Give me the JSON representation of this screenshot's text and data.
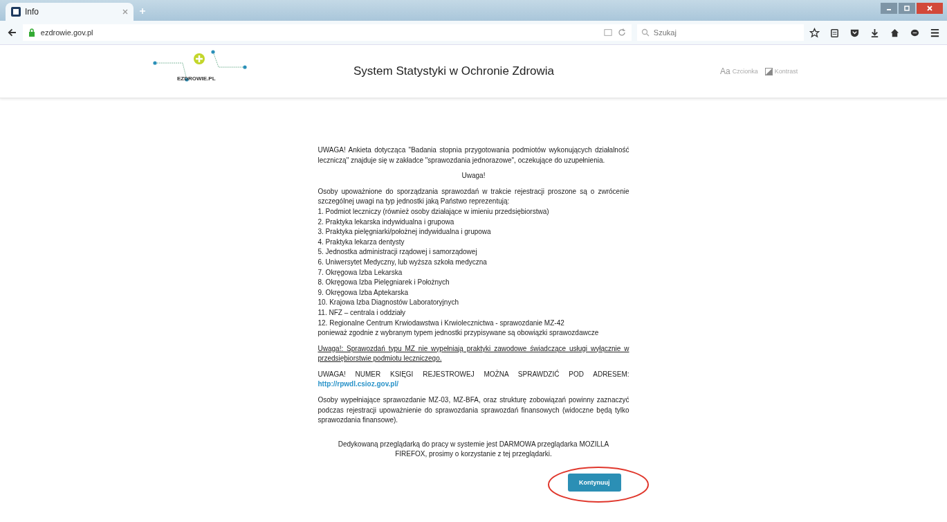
{
  "browser": {
    "tab_title": "Info",
    "url": "ezdrowie.gov.pl",
    "search_placeholder": "Szukaj"
  },
  "header": {
    "logo_text": "EZDROWIE.PL",
    "title": "System Statystyki w Ochronie Zdrowia",
    "font_icon": "Aa",
    "font_label": "Czcionka",
    "contrast_label": "Kontrast"
  },
  "notice": {
    "intro": "UWAGA! Ankieta dotycząca \"Badania stopnia przygotowania podmiotów wykonujących działalność leczniczą\" znajduje się w zakładce \"sprawozdania jednorazowe\", oczekujące do uzupełnienia.",
    "heading": "Uwaga!",
    "lead": "Osoby upoważnione do sporządzania sprawozdań w trakcie rejestracji proszone są o zwrócenie szczególnej uwagi na typ jednostki jaką Państwo reprezentują:",
    "items": [
      "1. Podmiot leczniczy (również osoby działające w imieniu przedsiębiorstwa)",
      "2. Praktyka lekarska indywidualna i grupowa",
      "3. Praktyka pielęgniarki/położnej indywidualna i grupowa",
      "4. Praktyka lekarza dentysty",
      "5. Jednostka administracji rządowej i samorządowej",
      "6. Uniwersytet Medyczny, lub wyższa szkoła medyczna",
      "7. Okręgowa Izba Lekarska",
      "8. Okręgowa Izba Pielęgniarek i Położnych",
      "9. Okręgowa Izba Aptekarska",
      "10. Krajowa Izba Diagnostów Laboratoryjnych",
      "11. NFZ – centrala i oddziały",
      "12. Regionalne Centrum Krwiodawstwa i Krwiolecznictwa - sprawozdanie MZ-42"
    ],
    "after_list": "ponieważ zgodnie z wybranym typem jednostki przypisywane są obowiązki sprawozdawcze",
    "underlined_note": "Uwaga!: Sprawozdań typu MZ nie wypełniają praktyki zawodowe świadczące usługi wyłącznie w przedsiębiorstwie podmiotu leczniczego.",
    "register_text": "UWAGA! NUMER KSIĘGI REJESTROWEJ MOŻNA SPRAWDZIĆ POD ADRESEM:",
    "register_link": "http://rpwdl.csioz.gov.pl/",
    "financial": "Osoby wypełniające sprawozdanie MZ-03, MZ-BFA, oraz strukturę zobowiązań powinny zaznaczyć podczas rejestracji upoważnienie do sprawozdania sprawozdań finansowych (widoczne będą tylko sprawozdania finansowe).",
    "browser_note": "Dedykowaną przeglądarką do pracy w systemie jest DARMOWA przeglądarka MOZILLA FIREFOX, prosimy o korzystanie z tej przeglądarki.",
    "button": "Kontynuuj"
  }
}
